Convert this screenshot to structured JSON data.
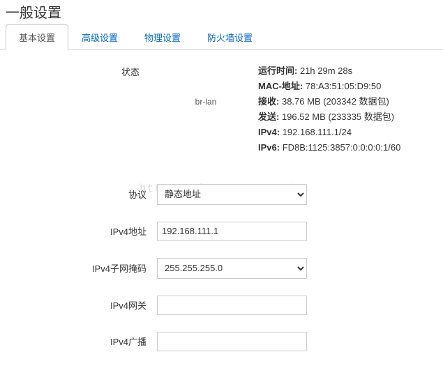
{
  "page_title": "一般设置",
  "tabs": {
    "basic": "基本设置",
    "advanced": "高级设置",
    "physical": "物理设置",
    "firewall": "防火墙设置"
  },
  "status": {
    "label": "状态",
    "iface": "br-lan",
    "uptime_k": "运行时间:",
    "uptime_v": "21h 29m 28s",
    "mac_k": "MAC-地址:",
    "mac_v": "78:A3:51:05:D9:50",
    "rx_k": "接收:",
    "rx_v": "38.76 MB (203342 数据包)",
    "tx_k": "发送:",
    "tx_v": "196.52 MB (233335 数据包)",
    "ipv4_k": "IPv4:",
    "ipv4_v": "192.168.111.1/24",
    "ipv6_k": "IPv6:",
    "ipv6_v": "FD8B:1125:3857:0:0:0:0:1/60"
  },
  "form": {
    "protocol_label": "协议",
    "protocol_value": "静态地址",
    "ipv4addr_label": "IPv4地址",
    "ipv4addr_value": "192.168.111.1",
    "netmask_label": "IPv4子网掩码",
    "netmask_value": "255.255.255.0",
    "gateway_label": "IPv4网关",
    "gateway_value": "",
    "broadcast_label": "IPv4广播",
    "broadcast_value": ""
  },
  "watermark": "http://blog.csdn.net/"
}
